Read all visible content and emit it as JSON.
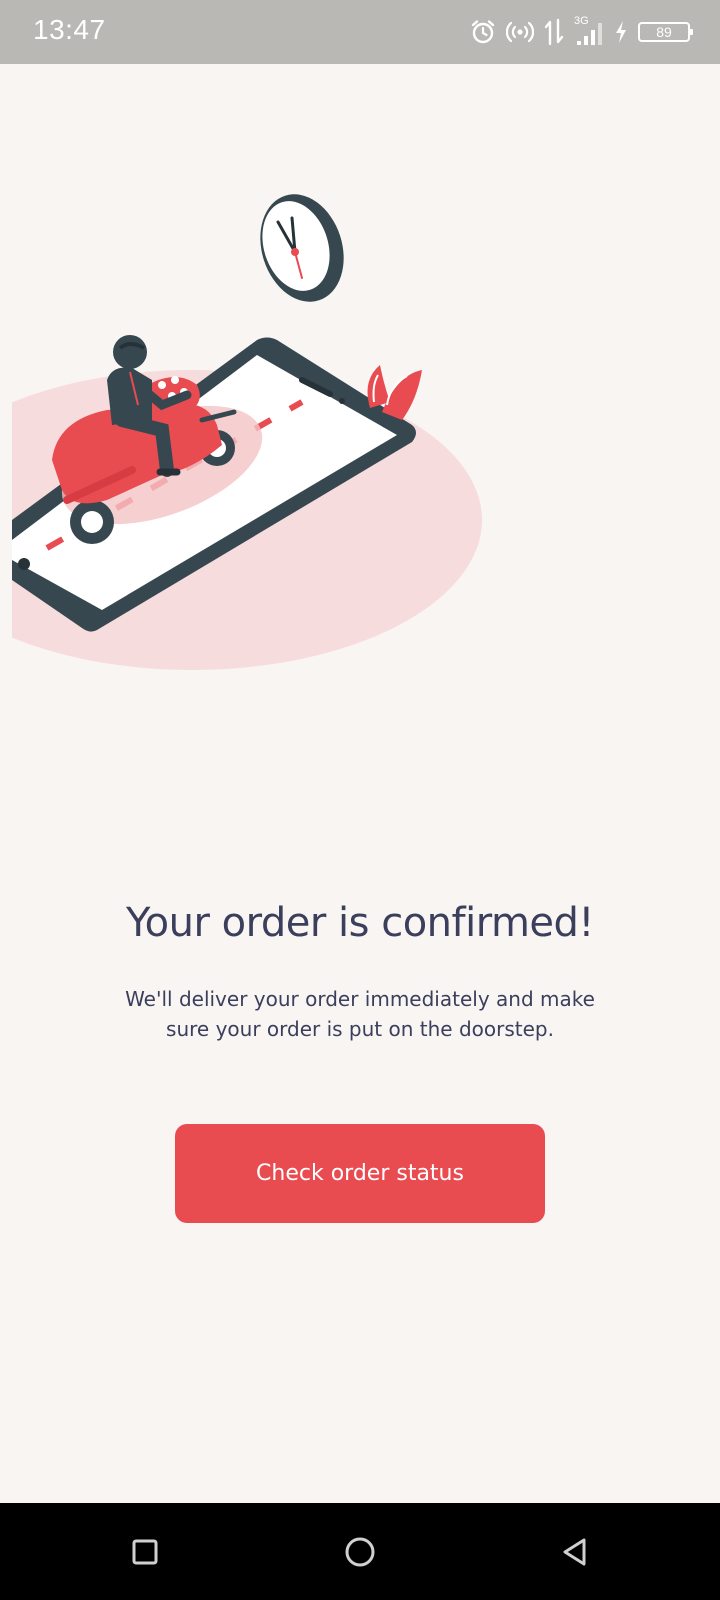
{
  "status_bar": {
    "time": "13:47",
    "battery_level": "89",
    "network_type": "3G",
    "icons": [
      "alarm-icon",
      "hotspot-icon",
      "data-transfer-icon",
      "signal-icon",
      "charging-icon",
      "battery-icon"
    ]
  },
  "illustration": {
    "name": "delivery-scooter-illustration",
    "colors": {
      "accent": "#e84c51",
      "blob": "#f7dcdd",
      "phone": "#37474f"
    }
  },
  "confirmation": {
    "title": "Your order is confirmed!",
    "subtitle": "We'll deliver your order immediately and make sure your order is put on the doorstep."
  },
  "actions": {
    "check_status_label": "Check order status"
  },
  "nav": {
    "icons": [
      "recents-square-icon",
      "home-circle-icon",
      "back-triangle-icon"
    ]
  },
  "colors": {
    "background": "#f8f5f3",
    "primary": "#e84c51",
    "text": "#3b3f5c",
    "status_bar": "#b9b8b4"
  }
}
